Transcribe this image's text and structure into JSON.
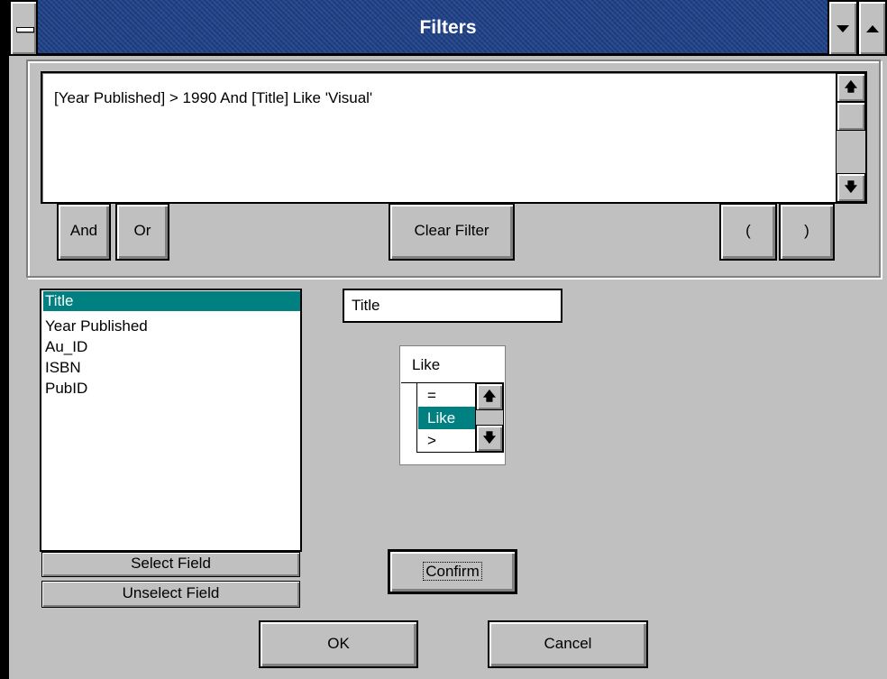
{
  "window": {
    "title": "Filters"
  },
  "filter_expression": {
    "text": "[Year Published] > 1990 And  [Title] Like 'Visual'"
  },
  "expression_buttons": {
    "and_label": "And",
    "or_label": "Or",
    "clear_filter_label": "Clear Filter",
    "open_paren_label": "(",
    "close_paren_label": ")"
  },
  "field_list": {
    "items": [
      "Title",
      "Year Published",
      "Au_ID",
      "ISBN",
      "PubID"
    ],
    "selected": "Title",
    "select_field_label": "Select Field",
    "unselect_field_label": "Unselect Field"
  },
  "selected_field": {
    "value": "Title"
  },
  "operator": {
    "current": "Like",
    "visible_options": [
      "=",
      "Like",
      ">"
    ],
    "selected": "Like"
  },
  "actions": {
    "confirm_label": "Confirm",
    "ok_label": "OK",
    "cancel_label": "Cancel"
  },
  "colors": {
    "titlebar": "#1c3f86",
    "selection": "#008080",
    "face": "#c0c0c0"
  }
}
